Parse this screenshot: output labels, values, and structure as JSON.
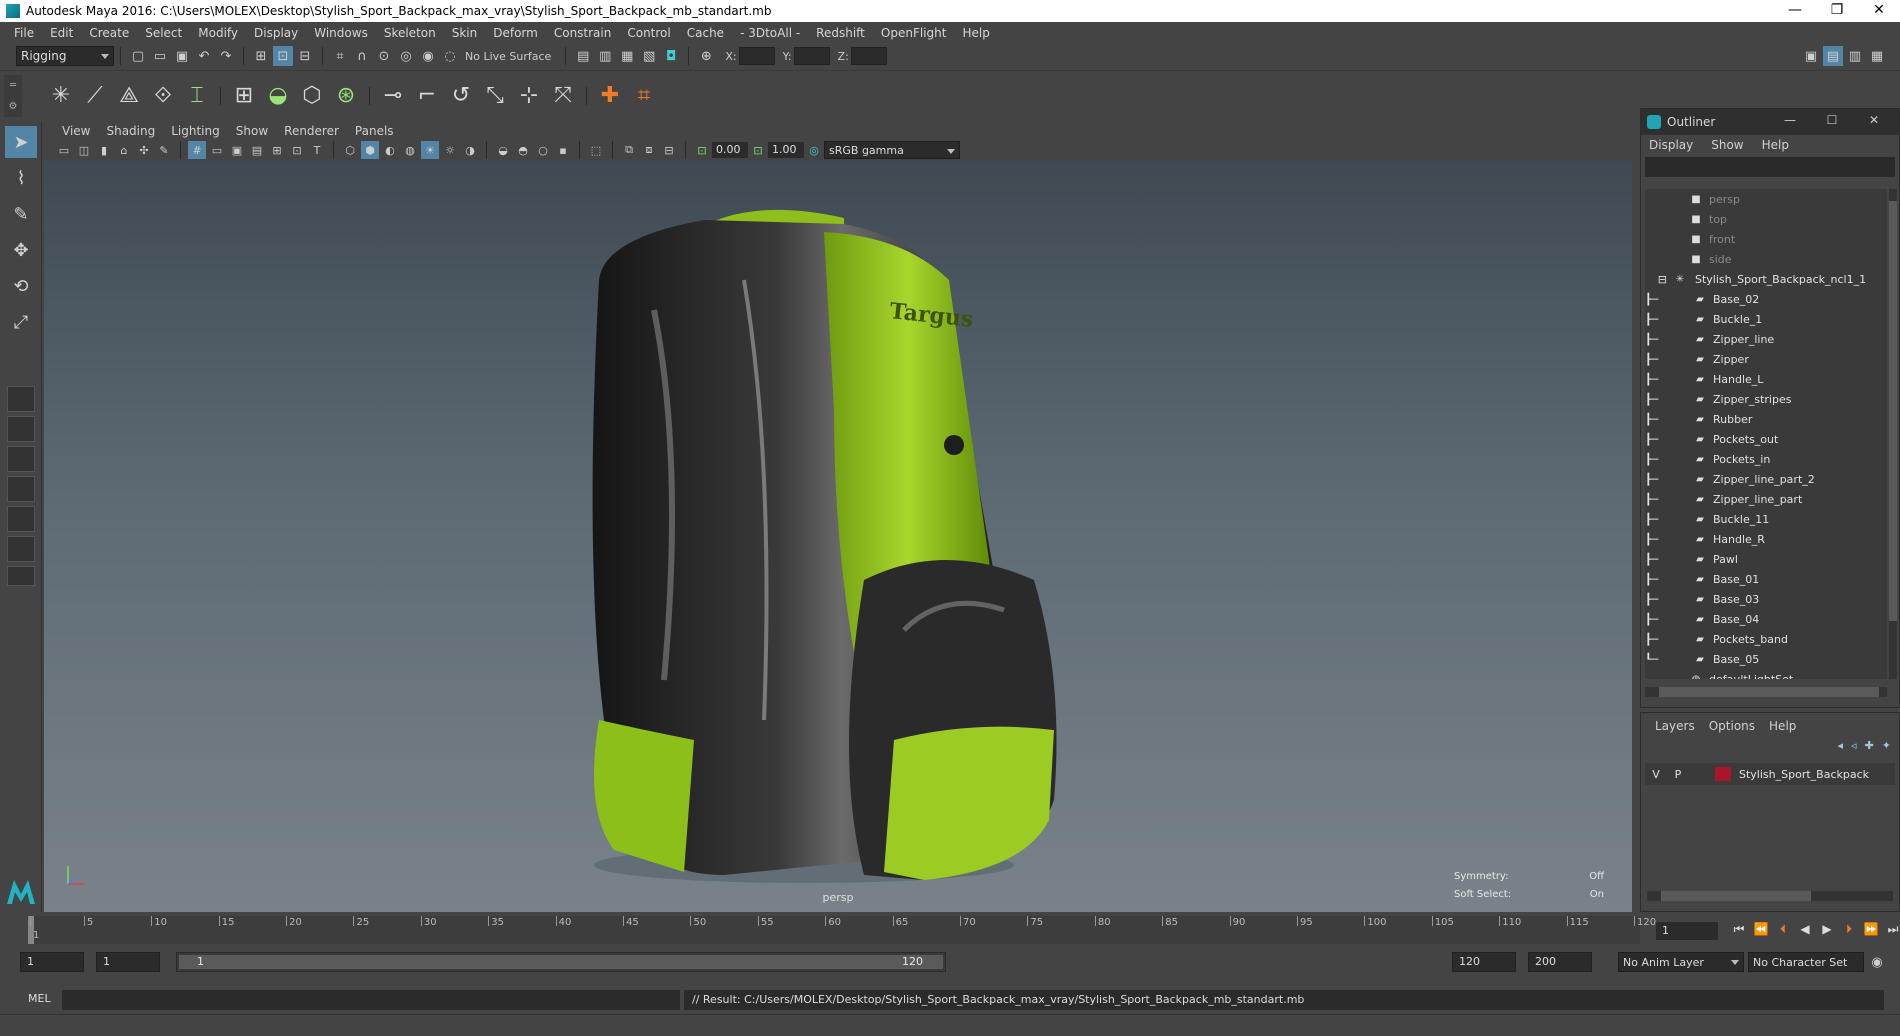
{
  "window": {
    "title": "Autodesk Maya 2016: C:\\Users\\MOLEX\\Desktop\\Stylish_Sport_Backpack_max_vray\\Stylish_Sport_Backpack_mb_standart.mb",
    "minimize": "—",
    "restore": "❐",
    "close": "✕"
  },
  "menubar": [
    "File",
    "Edit",
    "Create",
    "Select",
    "Modify",
    "Display",
    "Windows",
    "Skeleton",
    "Skin",
    "Deform",
    "Constrain",
    "Control",
    "Cache",
    "- 3DtoAll -",
    "Redshift",
    "OpenFlight",
    "Help"
  ],
  "statusline": {
    "menuset": "Rigging",
    "live_surface": "No Live Surface",
    "x_label": "X:",
    "y_label": "Y:",
    "z_label": "Z:"
  },
  "viewport": {
    "menus": [
      "View",
      "Shading",
      "Lighting",
      "Show",
      "Renderer",
      "Panels"
    ],
    "exposure": "0.00",
    "gamma": "1.00",
    "colorspace": "sRGB gamma",
    "camera": "persp",
    "symmetry_label": "Symmetry:",
    "symmetry_value": "Off",
    "softselect_label": "Soft Select:",
    "softselect_value": "On",
    "logo_text": "Targus"
  },
  "outliner": {
    "title": "Outliner",
    "menus": [
      "Display",
      "Show",
      "Help"
    ],
    "cameras": [
      "persp",
      "top",
      "front",
      "side"
    ],
    "group": "Stylish_Sport_Backpack_ncl1_1",
    "children": [
      "Base_02",
      "Buckle_1",
      "Zipper_line",
      "Zipper",
      "Handle_L",
      "Zipper_stripes",
      "Rubber",
      "Pockets_out",
      "Pockets_in",
      "Zipper_line_part_2",
      "Zipper_line_part",
      "Buckle_11",
      "Handle_R",
      "Pawl",
      "Base_01",
      "Base_03",
      "Base_04",
      "Pockets_band",
      "Base_05"
    ],
    "light_set": "defaultLightSet"
  },
  "layers": {
    "menus": [
      "Layers",
      "Options",
      "Help"
    ],
    "v": "V",
    "p": "P",
    "layer_name": "Stylish_Sport_Backpack",
    "layer_color": "#a9162a"
  },
  "timeline": {
    "ticks": [
      "1",
      "5",
      "10",
      "15",
      "20",
      "25",
      "30",
      "35",
      "40",
      "45",
      "50",
      "55",
      "60",
      "65",
      "70",
      "75",
      "80",
      "85",
      "90",
      "95",
      "100",
      "105",
      "110",
      "115",
      "120"
    ],
    "current_frame": "1"
  },
  "range": {
    "start": "1",
    "playback_start": "1",
    "range_start_label": "1",
    "range_end_label": "120",
    "playback_end": "120",
    "end": "200",
    "anim_layer": "No Anim Layer",
    "character_set": "No Character Set"
  },
  "command": {
    "language": "MEL",
    "result": "// Result: C:/Users/MOLEX/Desktop/Stylish_Sport_Backpack_max_vray/Stylish_Sport_Backpack_mb_standart.mb"
  }
}
